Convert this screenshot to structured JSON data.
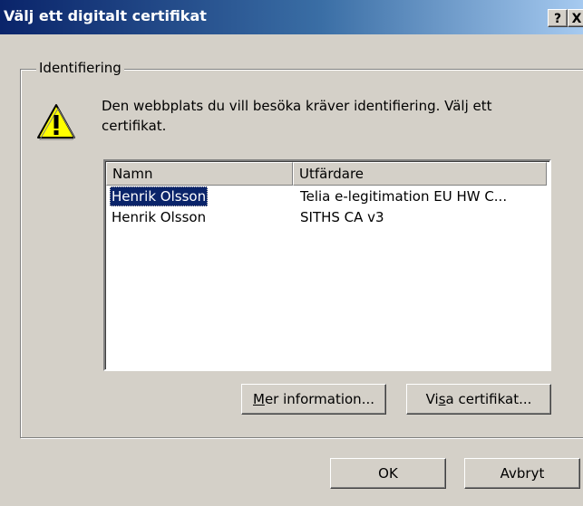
{
  "window": {
    "title": "Välj ett digitalt certifikat",
    "help_button": "?",
    "close_button": "X"
  },
  "group": {
    "label": "Identifiering"
  },
  "message": "Den webbplats du vill besöka kräver identifiering. Välj ett certifikat.",
  "icon": {
    "warning": "warning-icon"
  },
  "list": {
    "columns": [
      "Namn",
      "Utfärdare"
    ],
    "rows": [
      {
        "name": "Henrik Olsson",
        "issuer": "Telia e-legitimation EU HW C...",
        "selected": true
      },
      {
        "name": "Henrik Olsson",
        "issuer": "SITHS CA v3",
        "selected": false
      }
    ]
  },
  "buttons": {
    "mer_information": {
      "label_pre": "",
      "label_acc": "M",
      "label_post": "er information..."
    },
    "visa_certifikat": {
      "label_pre": "Vi",
      "label_acc": "s",
      "label_post": "a certifikat..."
    },
    "ok": "OK",
    "avbryt": "Avbryt"
  },
  "colors": {
    "titlebar_start": "#0a246a",
    "titlebar_end": "#a6caf0",
    "selection": "#0a246a",
    "face": "#d4d0c8"
  }
}
